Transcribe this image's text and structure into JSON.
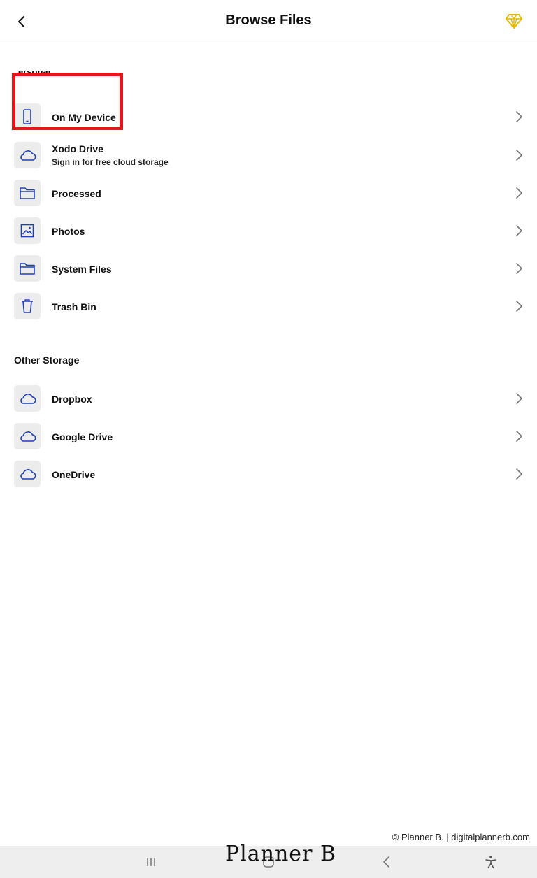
{
  "header": {
    "title": "Browse Files",
    "back_icon": "chevron-left-icon",
    "premium_icon": "diamond-icon",
    "premium_color": "#e8b90a"
  },
  "personal": {
    "heading": "ersonal",
    "items": [
      {
        "label": "On My Device",
        "icon": "phone-icon"
      },
      {
        "label": "Xodo Drive",
        "sublabel": "Sign in for free cloud storage",
        "icon": "cloud-icon"
      },
      {
        "label": "Processed",
        "icon": "folder-icon"
      },
      {
        "label": "Photos",
        "icon": "image-icon"
      },
      {
        "label": "System Files",
        "icon": "folder-icon"
      },
      {
        "label": "Trash Bin",
        "icon": "trash-icon"
      }
    ]
  },
  "other": {
    "heading": "Other Storage",
    "items": [
      {
        "label": "Dropbox",
        "icon": "cloud-icon"
      },
      {
        "label": "Google Drive",
        "icon": "cloud-icon"
      },
      {
        "label": "OneDrive",
        "icon": "cloud-icon"
      }
    ]
  },
  "colors": {
    "icon_blue": "#1f3fb8",
    "highlight_red": "#e3161b",
    "icon_bg": "#ececec"
  },
  "watermark": "© Planner B. | digitalplannerb.com",
  "brand": "Planner B",
  "navbar": {
    "recent_icon": "recent-apps-icon",
    "home_icon": "home-icon",
    "back_icon": "nav-back-icon",
    "accessibility_icon": "accessibility-icon"
  }
}
